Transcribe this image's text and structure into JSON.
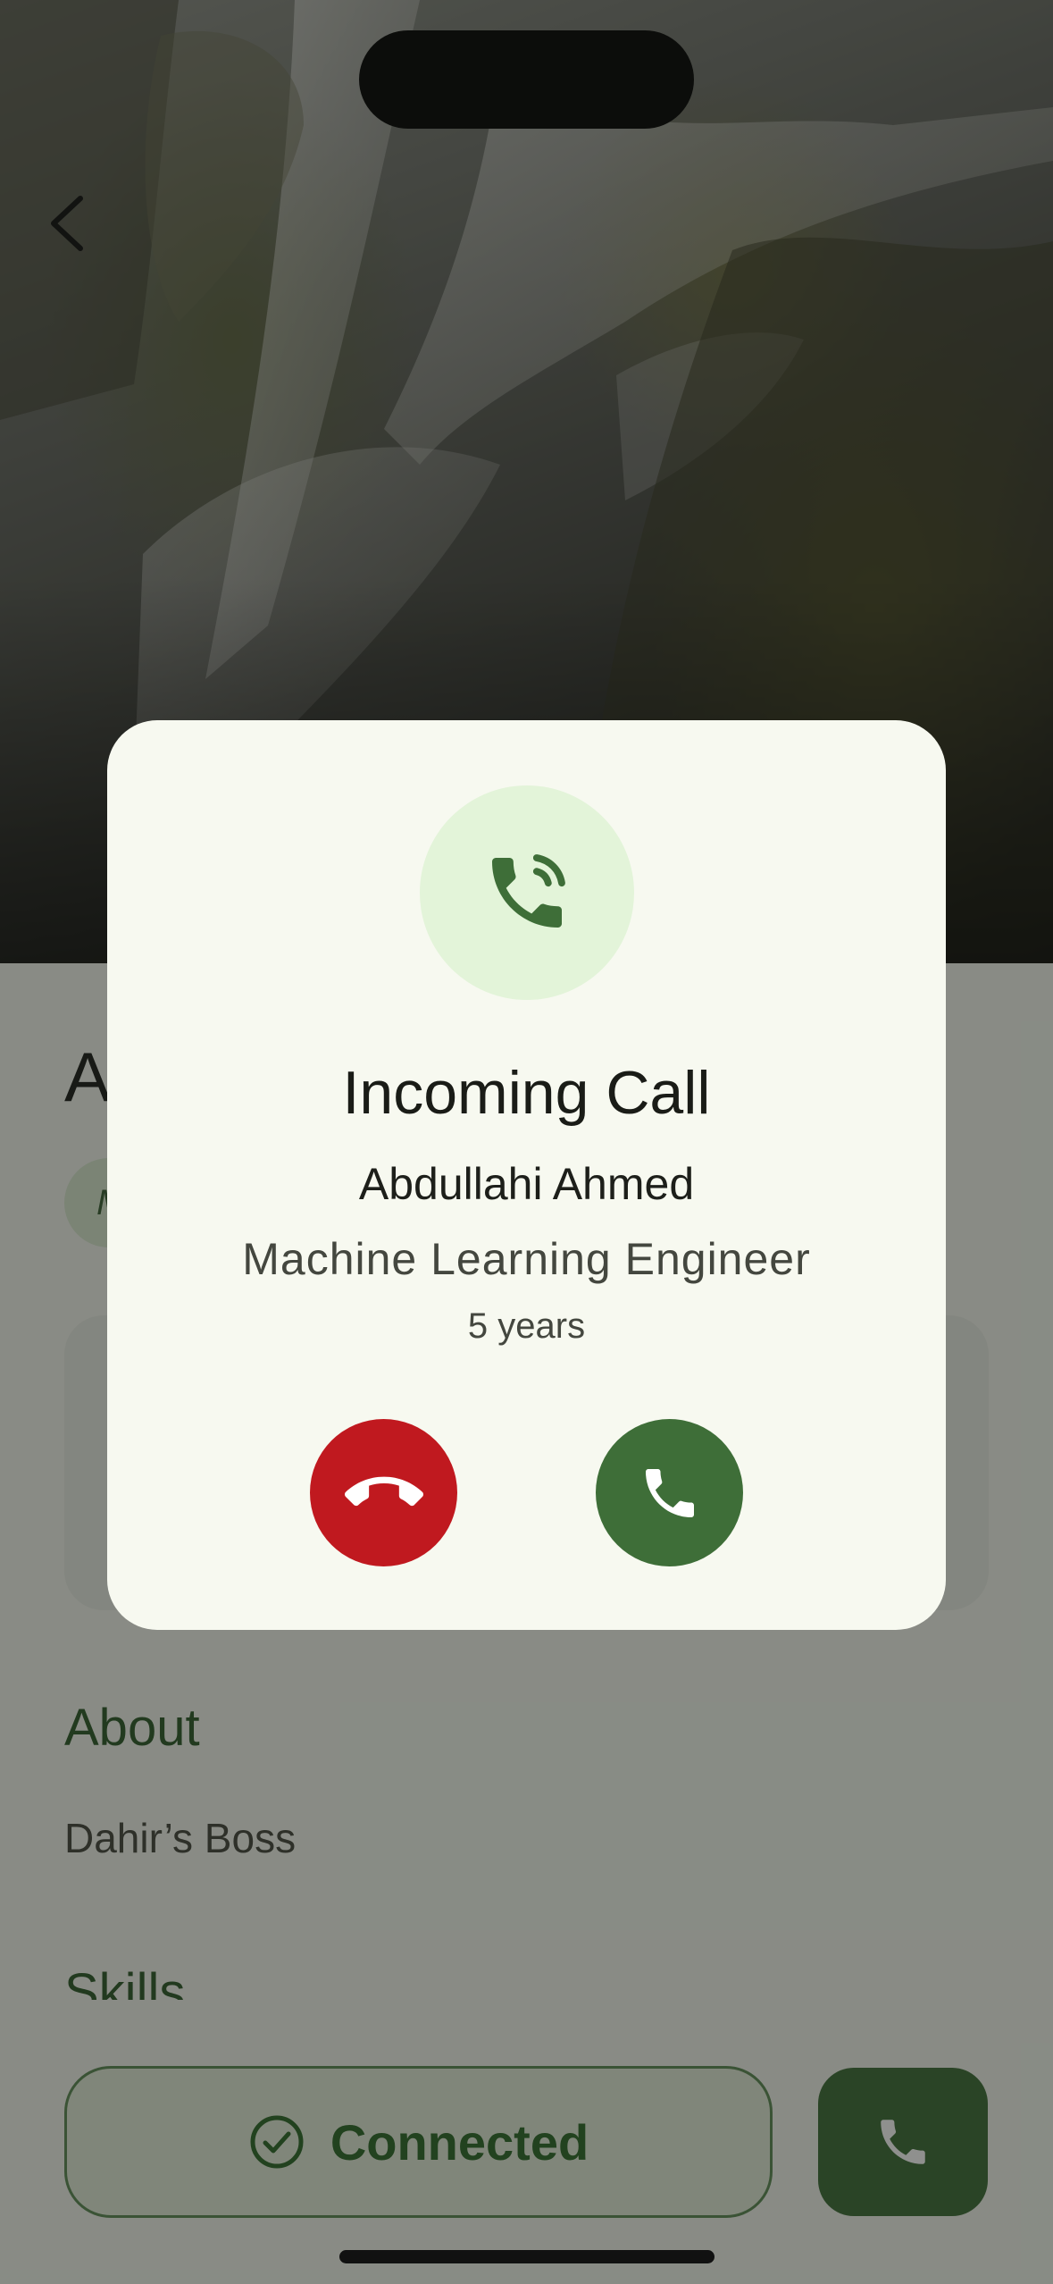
{
  "header": {
    "back_label": "Back"
  },
  "profile": {
    "name_initial": "A",
    "chip_initial": "M",
    "about_title": "About",
    "about_text": "Dahir’s Boss",
    "skills_title": "Skills"
  },
  "bottom": {
    "connected_label": "Connected"
  },
  "dialog": {
    "title": "Incoming Call",
    "caller_name": "Abdullahi Ahmed",
    "caller_role": "Machine Learning Engineer",
    "caller_experience": "5 years"
  },
  "icons": {
    "dialog_icon": "phone-in-talk-icon",
    "decline_icon": "call-end-icon",
    "accept_icon": "phone-icon",
    "connected_icon": "check-circle-icon",
    "back_icon": "chevron-left-icon"
  },
  "colors": {
    "primary_green": "#3e6e38",
    "decline_red": "#c0191f",
    "dialog_surface": "#f7f9f0",
    "icon_circle": "#e3f4d9"
  }
}
